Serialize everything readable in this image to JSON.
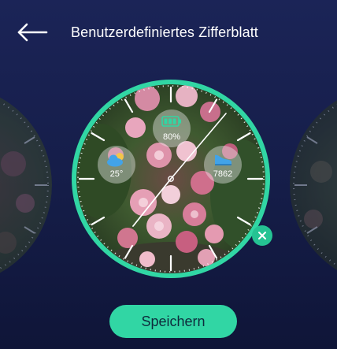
{
  "header": {
    "title": "Benutzerdefiniertes Zifferblatt",
    "back_icon": "arrow-left-icon"
  },
  "watch_face": {
    "battery": {
      "icon": "battery-icon",
      "value": "80%"
    },
    "weather": {
      "icon": "weather-cloudy-sun-icon",
      "value": "25°"
    },
    "steps": {
      "icon": "shoe-steps-icon",
      "value": "7862"
    },
    "hands": {
      "hour_deg": 220,
      "minute_deg": 40
    },
    "accent_color": "#31d6a4",
    "background_image": "pink-roses-photo"
  },
  "actions": {
    "delete_icon": "close-icon",
    "save_label": "Speichern"
  },
  "colors": {
    "background": "#141c44",
    "accent": "#31d6a4",
    "button_text": "#0e2b3c"
  }
}
